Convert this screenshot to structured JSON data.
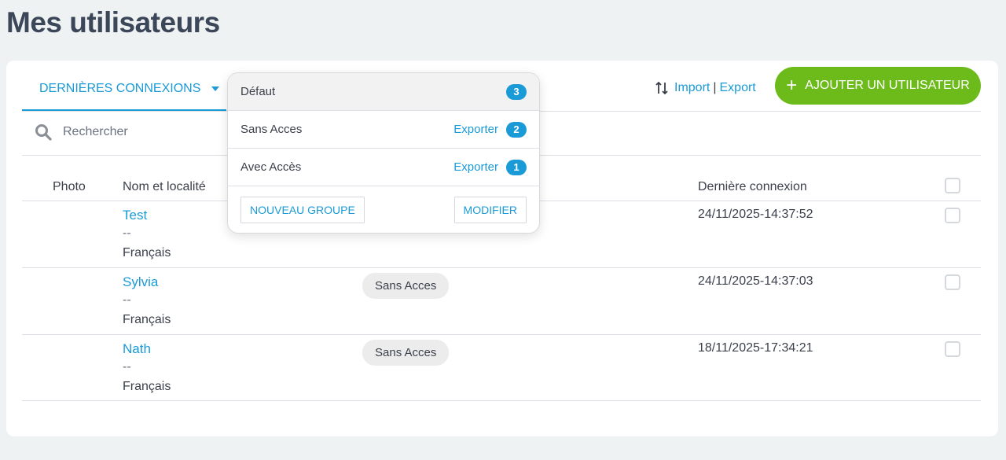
{
  "page": {
    "title": "Mes utilisateurs"
  },
  "tab": {
    "label": "DERNIÈRES CONNEXIONS"
  },
  "actions": {
    "import": "Import",
    "separator": "|",
    "export": "Export",
    "add_user": "AJOUTER UN UTILISATEUR"
  },
  "search": {
    "placeholder": "Rechercher"
  },
  "table": {
    "headers": {
      "photo": "Photo",
      "name": "Nom et localité",
      "last_login": "Dernière connexion"
    },
    "rows": [
      {
        "name": "Test",
        "dash": "--",
        "lang": "Français",
        "group": "",
        "date": "24/11/2025-14:37:52"
      },
      {
        "name": "Sylvia",
        "dash": "--",
        "lang": "Français",
        "group": "Sans Acces",
        "date": "24/11/2025-14:37:03"
      },
      {
        "name": "Nath",
        "dash": "--",
        "lang": "Français",
        "group": "Sans Acces",
        "date": "18/11/2025-17:34:21"
      }
    ]
  },
  "dropdown": {
    "items": [
      {
        "label": "Défaut",
        "export": "",
        "count": "3"
      },
      {
        "label": "Sans Acces",
        "export": "Exporter",
        "count": "2"
      },
      {
        "label": "Avec Accès",
        "export": "Exporter",
        "count": "1"
      }
    ],
    "new_group": "NOUVEAU GROUPE",
    "modify": "MODIFIER"
  },
  "colors": {
    "accent": "#1a9ad6",
    "primary_button": "#6cbb1b",
    "background": "#eef2f3"
  }
}
